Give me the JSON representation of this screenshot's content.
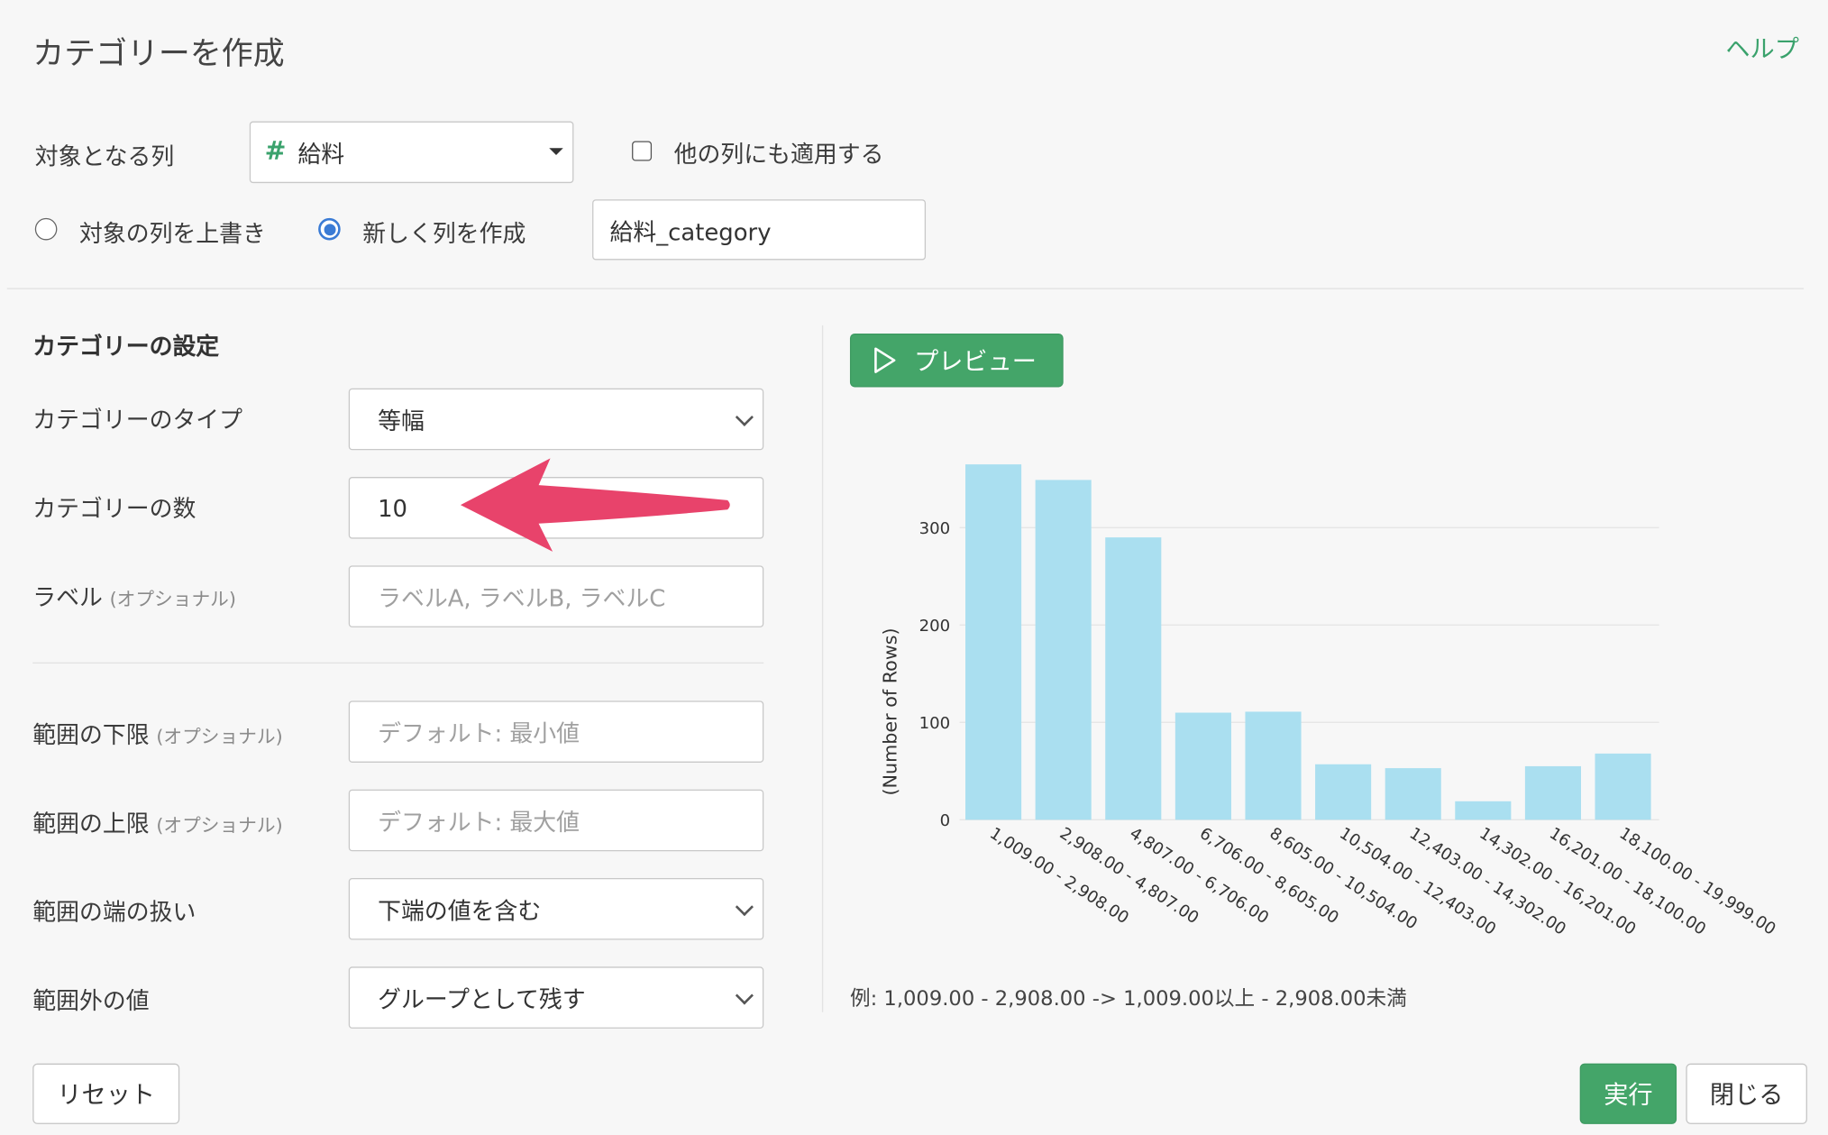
{
  "header": {
    "title": "カテゴリーを作成",
    "help_link": "ヘルプ"
  },
  "target": {
    "label": "対象となる列",
    "column_icon": "#",
    "column_value": "給料",
    "apply_other_label": "他の列にも適用する",
    "overwrite_label": "対象の列を上書き",
    "create_new_label": "新しく列を作成",
    "new_column_name": "給料_category"
  },
  "settings": {
    "section_title": "カテゴリーの設定",
    "optional_tag": "(オプショナル)",
    "type_label": "カテゴリーのタイプ",
    "type_value": "等幅",
    "count_label": "カテゴリーの数",
    "count_value": "10",
    "label_label": "ラベル",
    "label_placeholder": "ラベルA, ラベルB, ラベルC",
    "lower_label": "範囲の下限",
    "lower_placeholder": "デフォルト: 最小値",
    "upper_label": "範囲の上限",
    "upper_placeholder": "デフォルト: 最大値",
    "edge_label": "範囲の端の扱い",
    "edge_value": "下端の値を含む",
    "outside_label": "範囲外の値",
    "outside_value": "グループとして残す"
  },
  "preview": {
    "button_label": "プレビュー",
    "example_text": "例: 1,009.00 - 2,908.00 -> 1,009.00以上 - 2,908.00未満"
  },
  "footer": {
    "reset_label": "リセット",
    "run_label": "実行",
    "close_label": "閉じる"
  },
  "colors": {
    "accent_green": "#44a569",
    "bar": "#aadff0",
    "annotation_arrow": "#e8436b",
    "radio_selected": "#3a7bd5"
  },
  "chart_data": {
    "type": "bar",
    "ylabel": "(Number of Rows)",
    "ylim": [
      0,
      360
    ],
    "yticks": [
      0,
      100,
      200,
      300
    ],
    "grid": true,
    "categories": [
      "1,009.00 - 2,908.00",
      "2,908.00 - 4,807.00",
      "4,807.00 - 6,706.00",
      "6,706.00 - 8,605.00",
      "8,605.00 - 10,504.00",
      "10,504.00 - 12,403.00",
      "12,403.00 - 14,302.00",
      "14,302.00 - 16,201.00",
      "16,201.00 - 18,100.00",
      "18,100.00 - 19,999.00"
    ],
    "values": [
      365,
      349,
      290,
      110,
      111,
      57,
      53,
      19,
      55,
      68
    ]
  }
}
